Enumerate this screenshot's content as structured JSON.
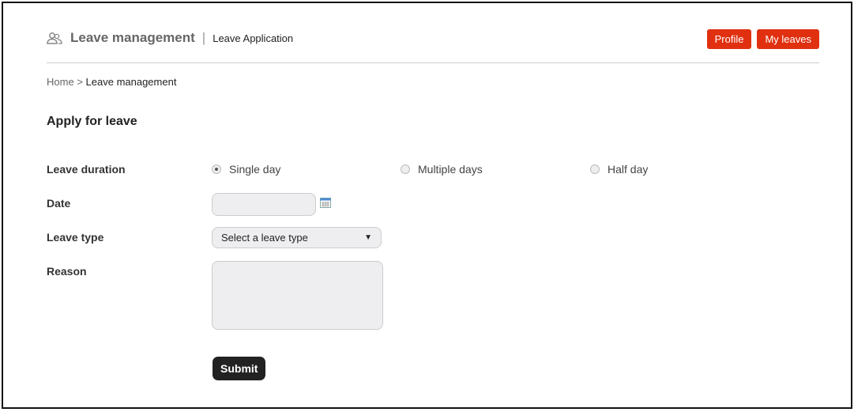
{
  "header": {
    "title": "Leave management",
    "separator": "|",
    "subtitle": "Leave Application",
    "buttons": {
      "profile": "Profile",
      "my_leaves": "My leaves"
    },
    "accent": "#e03010"
  },
  "breadcrumb": {
    "home": "Home",
    "separator": ">",
    "current": "Leave management"
  },
  "form": {
    "title": "Apply for leave",
    "duration_label": "Leave duration",
    "options": [
      "Single day",
      "Multiple days",
      "Half day"
    ],
    "selected": "Single day",
    "date_label": "Date",
    "date_value": "",
    "type_label": "Leave type",
    "type_value": "Select a leave type",
    "reason_label": "Reason",
    "reason_value": "",
    "submit": "Submit"
  }
}
